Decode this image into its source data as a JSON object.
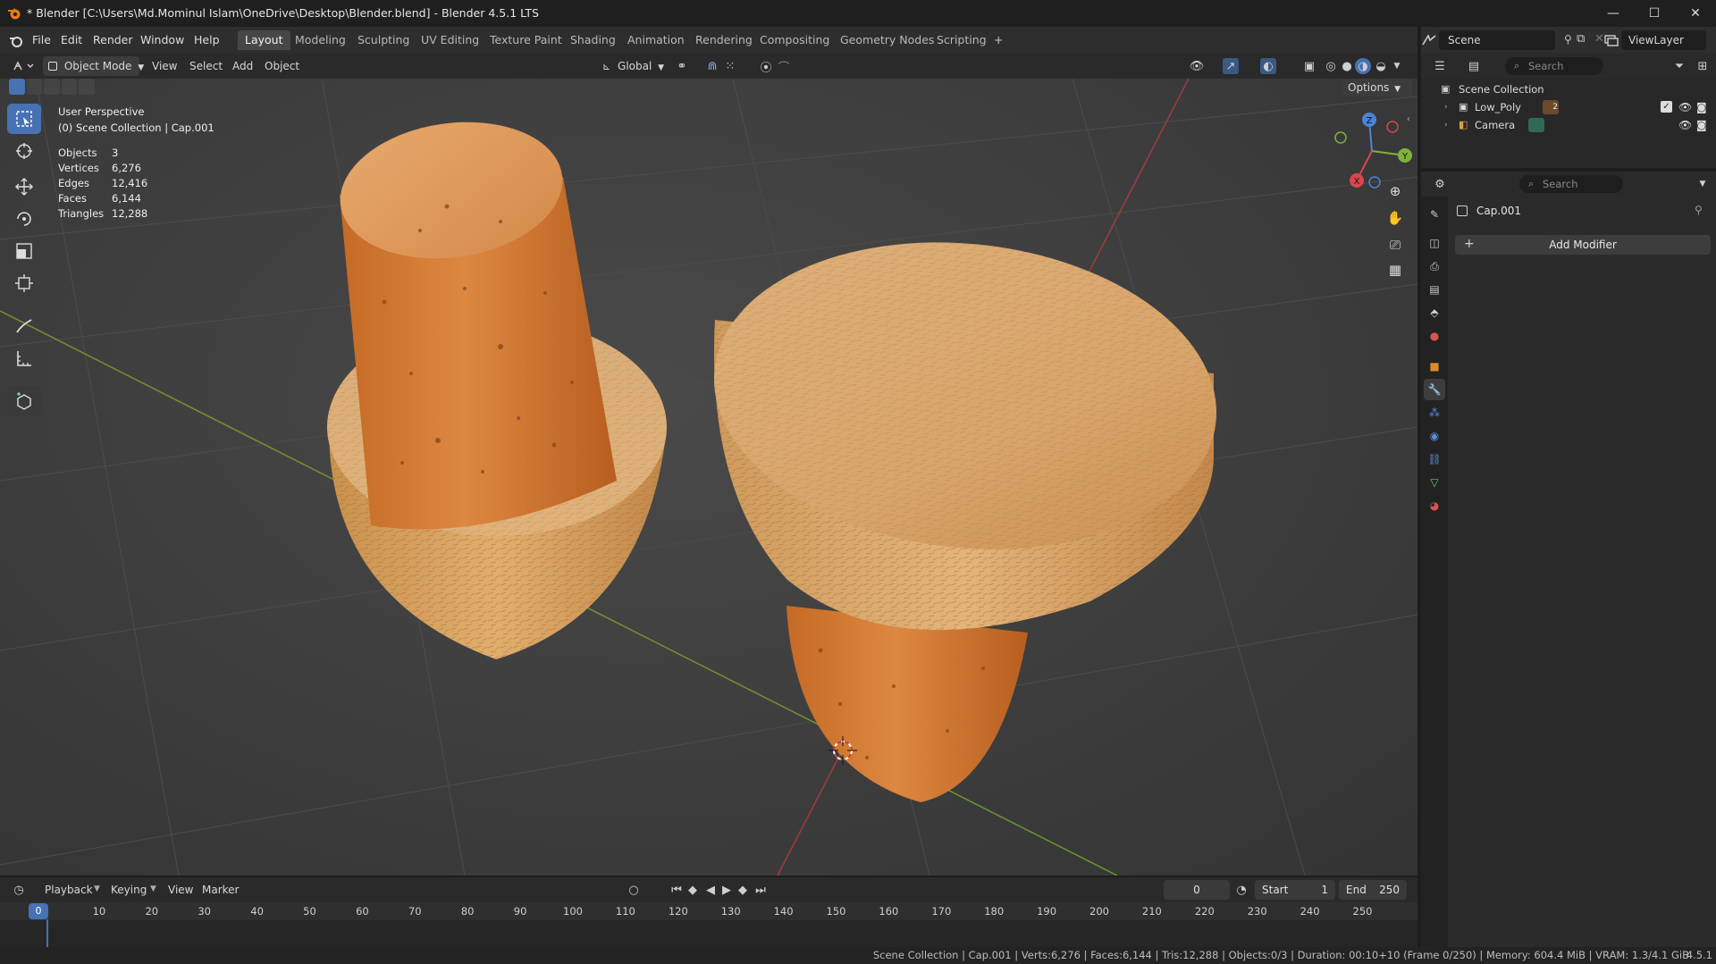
{
  "window": {
    "title": "* Blender [C:\\Users\\Md.Mominul Islam\\OneDrive\\Desktop\\Blender.blend] - Blender 4.5.1 LTS",
    "controls": [
      "—",
      "☐",
      "✕"
    ]
  },
  "menu": {
    "items": [
      "File",
      "Edit",
      "Render",
      "Window",
      "Help"
    ]
  },
  "workspaces": {
    "tabs": [
      "Layout",
      "Modeling",
      "Sculpting",
      "UV Editing",
      "Texture Paint",
      "Shading",
      "Animation",
      "Rendering",
      "Compositing",
      "Geometry Nodes",
      "Scripting"
    ],
    "active": "Layout",
    "add": "+"
  },
  "topright": {
    "scene": "Scene",
    "viewlayer": "ViewLayer"
  },
  "viewport_header": {
    "mode": "Object Mode",
    "menus": [
      "View",
      "Select",
      "Add",
      "Object"
    ],
    "transform_orientation": "Global",
    "options": "Options"
  },
  "viewport": {
    "perspective": "User Perspective",
    "collection": "(0) Scene Collection | Cap.001",
    "stats": [
      {
        "label": "Objects",
        "value": "3"
      },
      {
        "label": "Vertices",
        "value": "6,276"
      },
      {
        "label": "Edges",
        "value": "12,416"
      },
      {
        "label": "Faces",
        "value": "6,144"
      },
      {
        "label": "Triangles",
        "value": "12,288"
      }
    ],
    "gizmo": {
      "x": "X",
      "y": "Y",
      "z": "Z"
    }
  },
  "outliner": {
    "search_placeholder": "Search",
    "root": "Scene Collection",
    "items": [
      {
        "name": "Low_Poly",
        "badge": "2"
      },
      {
        "name": "Camera",
        "badge": ""
      }
    ]
  },
  "properties": {
    "search_placeholder": "Search",
    "object_name": "Cap.001",
    "add_modifier": "Add Modifier",
    "colors": {
      "accent": "#4772b3",
      "modifier_tab": "#5a8fd6"
    }
  },
  "timeline": {
    "menus": [
      "Playback",
      "Keying",
      "View",
      "Marker"
    ],
    "current_frame": "0",
    "start_label": "Start",
    "start_value": "1",
    "end_label": "End",
    "end_value": "250",
    "ticks": [
      "0",
      "10",
      "20",
      "30",
      "40",
      "50",
      "60",
      "70",
      "80",
      "90",
      "100",
      "110",
      "120",
      "130",
      "140",
      "150",
      "160",
      "170",
      "180",
      "190",
      "200",
      "210",
      "220",
      "230",
      "240",
      "250"
    ]
  },
  "status_bar": {
    "text": "Scene Collection | Cap.001 | Verts:6,276 | Faces:6,144 | Tris:12,288 | Objects:0/3 | Duration: 00:10+10 (Frame 0/250) | Memory: 604.4 MiB | VRAM: 1.3/4.1 GiB",
    "version": "4.5.1"
  }
}
